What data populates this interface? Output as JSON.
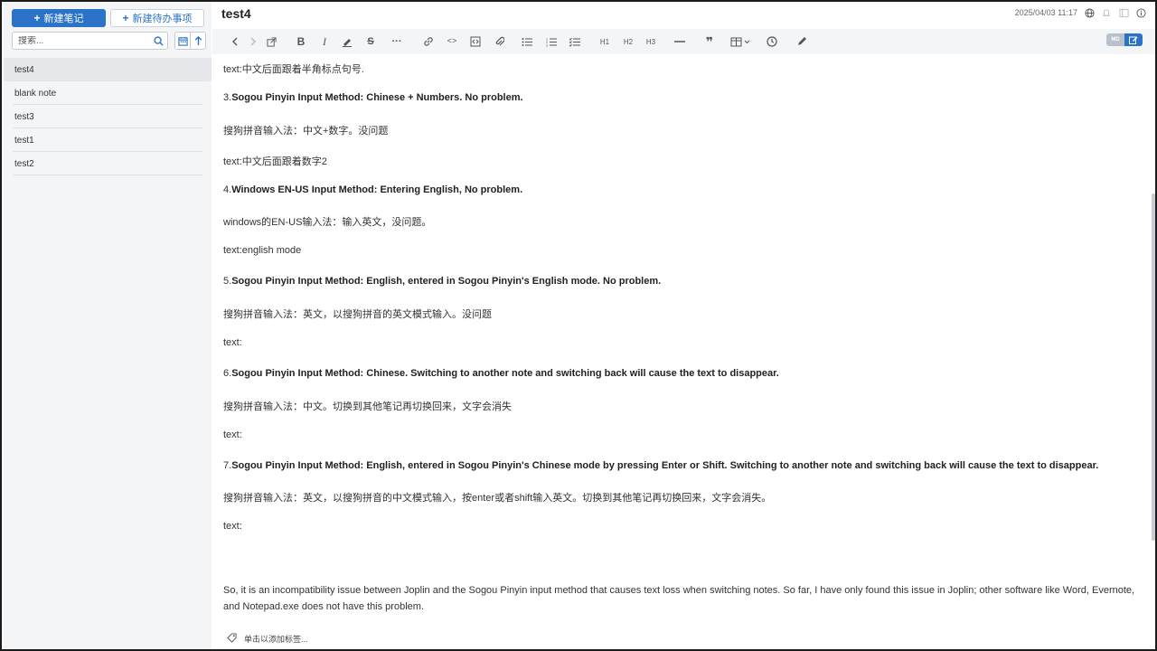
{
  "sidebar": {
    "new_note_label": "新建笔记",
    "new_todo_label": "新建待办事项",
    "search_placeholder": "搜索...",
    "notes": [
      {
        "title": "test4",
        "selected": true
      },
      {
        "title": "blank note",
        "selected": false
      },
      {
        "title": "test3",
        "selected": false
      },
      {
        "title": "test1",
        "selected": false
      },
      {
        "title": "test2",
        "selected": false
      }
    ]
  },
  "editor": {
    "title": "test4",
    "timestamp": "2025/04/03 11:17",
    "toolbar": {
      "h1": "H1",
      "h2": "H2",
      "h3": "H3",
      "toggle_md": "MD"
    },
    "content": [
      {
        "type": "text",
        "text": "text:中文后面跟着半角标点句号."
      },
      {
        "type": "heading",
        "num": "3.",
        "bold": "Sogou Pinyin Input Method: Chinese + Numbers. No problem."
      },
      {
        "type": "text",
        "text": "搜狗拼音输入法：中文+数字。没问题"
      },
      {
        "type": "text",
        "text": "text:中文后面跟着数字2"
      },
      {
        "type": "heading",
        "num": "4.",
        "bold": "Windows EN-US Input Method: Entering English, No problem."
      },
      {
        "type": "text",
        "text": "windows的EN-US输入法：输入英文，没问题。"
      },
      {
        "type": "text",
        "text": "text:english mode"
      },
      {
        "type": "heading",
        "num": "5.",
        "bold": "Sogou Pinyin Input Method: English, entered in Sogou Pinyin's English mode. No problem."
      },
      {
        "type": "text",
        "text": "搜狗拼音输入法：英文，以搜狗拼音的英文模式输入。没问题"
      },
      {
        "type": "text",
        "text": "text:"
      },
      {
        "type": "heading",
        "num": "6.",
        "bold": "Sogou Pinyin Input Method: Chinese. Switching to another note and switching back will cause the text to disappear."
      },
      {
        "type": "text",
        "text": "搜狗拼音输入法：中文。切换到其他笔记再切换回来，文字会消失"
      },
      {
        "type": "text",
        "text": "text:"
      },
      {
        "type": "heading",
        "num": "7.",
        "bold": "Sogou Pinyin Input Method: English, entered in Sogou Pinyin's Chinese mode by pressing Enter or Shift. Switching to another note and switching back will cause the text to disappear."
      },
      {
        "type": "text",
        "text": "搜狗拼音输入法：英文，以搜狗拼音的中文模式输入，按enter或者shift输入英文。切换到其他笔记再切换回来，文字会消失。"
      },
      {
        "type": "text",
        "text": "text:"
      }
    ],
    "summary": "So, it is an incompatibility issue between Joplin and the Sogou Pinyin input method that causes text loss when switching notes. So far, I have only found this issue in Joplin; other software like Word, Evernote, and Notepad.exe does not have this problem.",
    "tag_placeholder": "单击以添加标签..."
  }
}
